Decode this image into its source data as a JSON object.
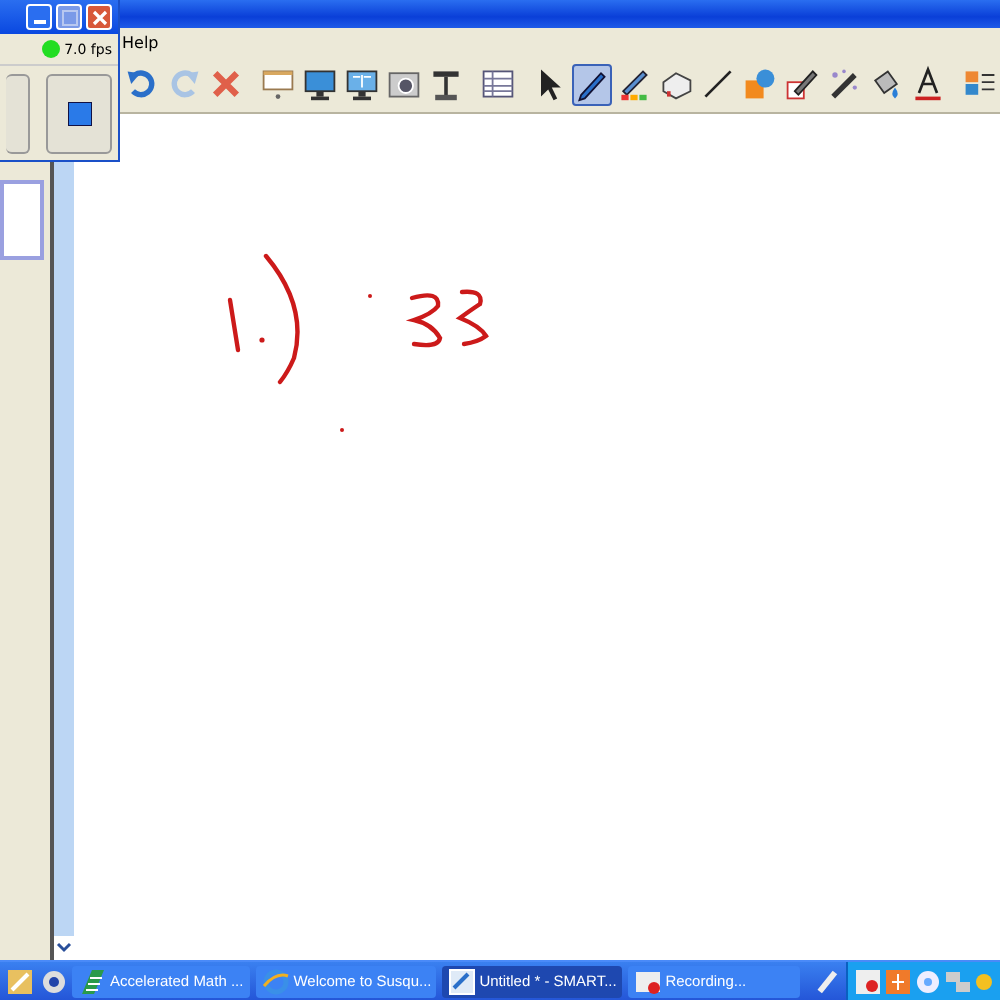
{
  "menu": [
    "Help"
  ],
  "toolbar_groups": [
    {
      "tools": [
        {
          "kind": "undo",
          "selected": false
        },
        {
          "kind": "redo",
          "selected": false
        },
        {
          "kind": "delete",
          "selected": false
        }
      ]
    },
    {
      "tools": [
        {
          "kind": "screen",
          "selected": false
        },
        {
          "kind": "monitor",
          "selected": false
        },
        {
          "kind": "monitor2",
          "selected": false
        },
        {
          "kind": "camera",
          "selected": false
        },
        {
          "kind": "doccam",
          "selected": false
        }
      ]
    },
    {
      "tools": [
        {
          "kind": "table",
          "selected": false
        }
      ]
    },
    {
      "tools": [
        {
          "kind": "select",
          "selected": false
        },
        {
          "kind": "pen",
          "selected": true
        },
        {
          "kind": "creative",
          "selected": false
        },
        {
          "kind": "eraser",
          "selected": false
        },
        {
          "kind": "line",
          "selected": false
        },
        {
          "kind": "shapes",
          "selected": false
        },
        {
          "kind": "magic",
          "selected": false
        },
        {
          "kind": "wand",
          "selected": false
        },
        {
          "kind": "fill",
          "selected": false
        },
        {
          "kind": "text",
          "selected": false
        }
      ]
    },
    {
      "tools": [
        {
          "kind": "props",
          "selected": false
        }
      ]
    }
  ],
  "recorder": {
    "fps": "7.0 fps"
  },
  "taskbar": [
    {
      "label": "Accelerated Math ...",
      "kind": "math",
      "selected": false
    },
    {
      "label": "Welcome to Susqu...",
      "kind": "browser",
      "selected": false
    },
    {
      "label": "Untitled * - SMART...",
      "kind": "notebook",
      "selected": true
    },
    {
      "label": "Recording...",
      "kind": "recorder",
      "selected": false
    }
  ]
}
